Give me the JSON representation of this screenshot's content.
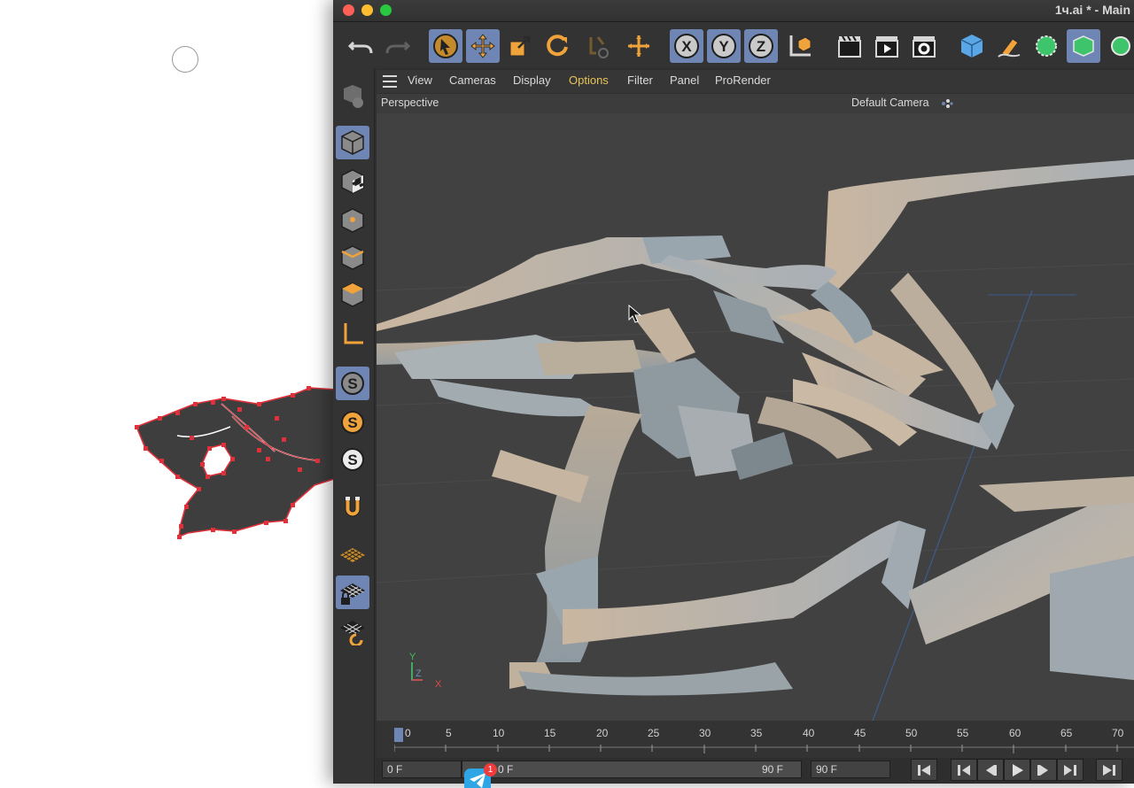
{
  "window": {
    "title": "1ч.ai * - Main"
  },
  "toolbar": {
    "undo_icon": "undo-icon",
    "redo_icon": "redo-icon",
    "tools": [
      "live-selection-icon",
      "move-icon",
      "scale-icon",
      "rotate-icon",
      "recent-tools-icon",
      "coordinate-icon",
      "x-axis-icon",
      "y-axis-icon",
      "z-axis-icon",
      "world-coords-icon",
      "render-view-icon",
      "render-picture-viewer-icon",
      "render-settings-icon",
      "cube-icon",
      "pen-icon",
      "subdivision-icon",
      "extrude-icon",
      "array-icon"
    ]
  },
  "left_palette": [
    "make-editable-icon",
    "model-mode-icon",
    "texture-mode-icon",
    "points-mode-icon",
    "edges-mode-icon",
    "polygons-mode-icon",
    "axis-mode-icon",
    "snap-icon",
    "soft-selection-icon",
    "solo-icon",
    "magnet-icon",
    "workplane-icon",
    "locked-workplane-icon",
    "planar-workplane-icon"
  ],
  "viewport": {
    "menu": [
      "View",
      "Cameras",
      "Display",
      "Options",
      "Filter",
      "Panel",
      "ProRender"
    ],
    "active_menu": "Options",
    "name": "Perspective",
    "camera": "Default Camera",
    "axis": {
      "y": "Y",
      "z": "Z",
      "x": "X"
    }
  },
  "timeline": {
    "ticks": [
      "0",
      "5",
      "10",
      "15",
      "20",
      "25",
      "30",
      "35",
      "40",
      "45",
      "50",
      "55",
      "60",
      "65",
      "70"
    ],
    "current_frame": "0 F",
    "preview_start": "0 F",
    "preview_end": "90 F",
    "end_frame": "90 F"
  },
  "dock": {
    "telegram_badge": "1"
  },
  "colors": {
    "accent_selected": "#6f86b4",
    "menu_highlight": "#e8c457",
    "shape_fill": "#c7b8a4",
    "ai_path": "#e0313b"
  }
}
